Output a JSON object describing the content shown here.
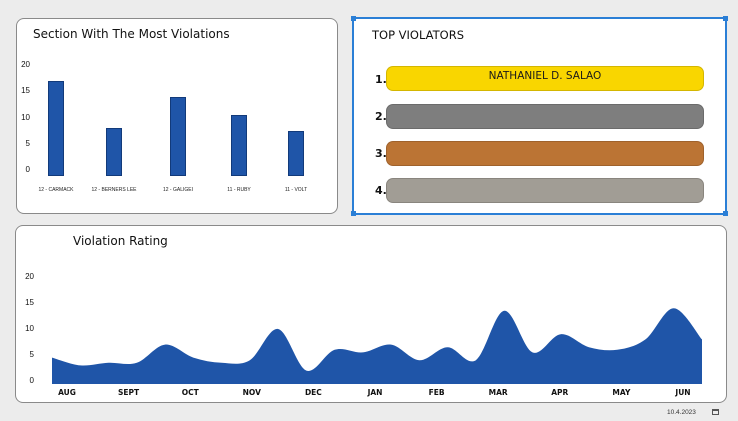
{
  "sections_chart": {
    "title": "Section With The Most Violations",
    "y_ticks": [
      "20",
      "15",
      "10",
      "5",
      "0"
    ],
    "color": "#1f55a8",
    "chart_data": {
      "type": "bar",
      "categories": [
        "12 - CARMACK",
        "12 - BERNERS LEE",
        "12 - GALIGEI",
        "11 - RUBY",
        "11 - VOLT"
      ],
      "values": [
        17,
        8,
        14,
        10.5,
        7.5
      ],
      "title": "Section With The Most Violations",
      "ylim": [
        0,
        20
      ]
    }
  },
  "top_violators": {
    "title": "TOP VIOLATORS",
    "entries": [
      {
        "rank": "1.",
        "name": "NATHANIEL D. SALAO",
        "color": "#f9d600"
      },
      {
        "rank": "2.",
        "name": "",
        "color": "#7e7e7e"
      },
      {
        "rank": "3.",
        "name": "",
        "color": "#bb7434"
      },
      {
        "rank": "4.",
        "name": "",
        "color": "#a19d95"
      }
    ]
  },
  "rating_chart": {
    "title": "Violation Rating",
    "y_ticks": [
      "20",
      "15",
      "10",
      "5",
      "0"
    ],
    "months": [
      "AUG",
      "SEPT",
      "OCT",
      "NOV",
      "DEC",
      "JAN",
      "FEB",
      "MAR",
      "APR",
      "MAY",
      "JUN"
    ],
    "color": "#1f55a8",
    "chart_data": {
      "type": "area",
      "x": [
        "AUG",
        "",
        "",
        "",
        "SEPT",
        "",
        "OCT",
        "",
        "NOV",
        "",
        "DEC",
        "",
        "JAN",
        "",
        "FEB",
        "",
        "MAR",
        "",
        "APR",
        "",
        "MAY",
        "",
        "JUN",
        ""
      ],
      "values": [
        4.5,
        3,
        3.5,
        3.5,
        7,
        4.5,
        3.5,
        4,
        10,
        2,
        6,
        5.5,
        7,
        4,
        6.5,
        4,
        13.5,
        5.5,
        9,
        6.5,
        6,
        8,
        14,
        8
      ],
      "ylim": [
        0,
        20
      ]
    }
  },
  "footer": {
    "date": "10.4.2023",
    "icon": "calendar-icon"
  }
}
